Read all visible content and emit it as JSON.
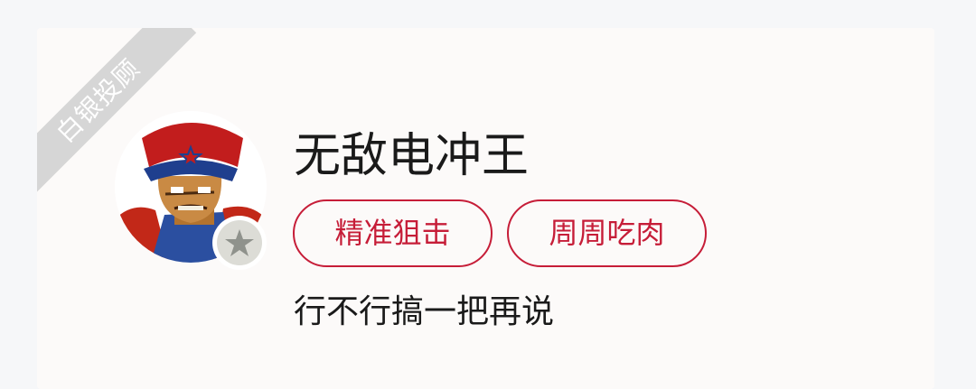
{
  "card": {
    "ribbon_label": "白银投顾",
    "name": "无敌电冲王",
    "tags": [
      "精准狙击",
      "周周吃肉"
    ],
    "motto": "行不行搞一把再说",
    "avatar_icon": "avatar-character-portrait",
    "rank_icon": "star-icon",
    "colors": {
      "tag_accent": "#c61d38",
      "ribbon": "#d6d6d6",
      "card_bg": "#fcfaf9"
    }
  }
}
